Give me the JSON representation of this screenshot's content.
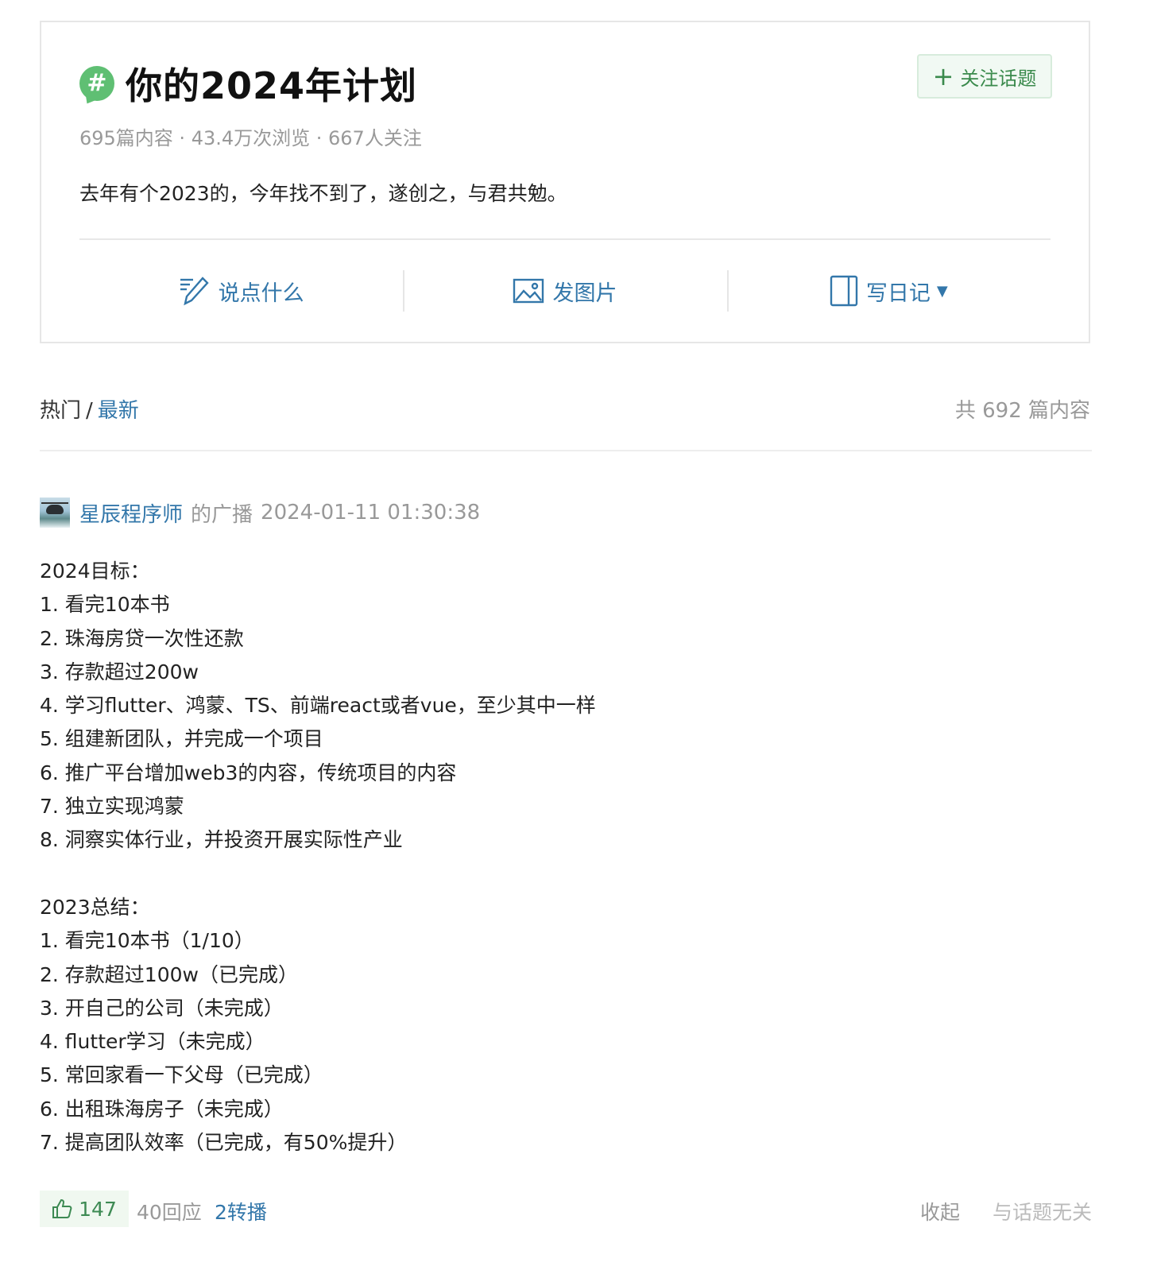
{
  "topic": {
    "title": "你的2024年计划",
    "follow_label": "关注话题",
    "meta": "695篇内容 · 43.4万次浏览 · 667人关注",
    "description": "去年有个2023的，今年找不到了，遂创之，与君共勉。",
    "actions": [
      {
        "label": "说点什么",
        "icon": "pencil-icon"
      },
      {
        "label": "发图片",
        "icon": "image-icon"
      },
      {
        "label": "写日记",
        "icon": "book-icon"
      }
    ]
  },
  "feed": {
    "tab_hot": "热门",
    "tab_sep": "/",
    "tab_latest": "最新",
    "count": "共 692 篇内容"
  },
  "post": {
    "author": "星辰程序师",
    "kind": "的广播",
    "time": "2024-01-11 01:30:38",
    "lines": [
      "2024目标：",
      "1. 看完10本书",
      "2. 珠海房贷一次性还款",
      "3. 存款超过200w",
      "4. 学习flutter、鸿蒙、TS、前端react或者vue，至少其中一样",
      "5. 组建新团队，并完成一个项目",
      "6. 推广平台增加web3的内容，传统项目的内容",
      "7. 独立实现鸿蒙",
      "8. 洞察实体行业，并投资开展实际性产业",
      "",
      "2023总结：",
      "1. 看完10本书（1/10）",
      "2. 存款超过100w（已完成）",
      "3. 开自己的公司（未完成）",
      "4. flutter学习（未完成）",
      "5. 常回家看一下父母（已完成）",
      "6. 出租珠海房子（未完成）",
      "7. 提高团队效率（已完成，有50%提升）"
    ],
    "likes": "147",
    "replies": "40回应",
    "reposts": "2转播",
    "collapse": "收起",
    "report": "与话题无关"
  }
}
